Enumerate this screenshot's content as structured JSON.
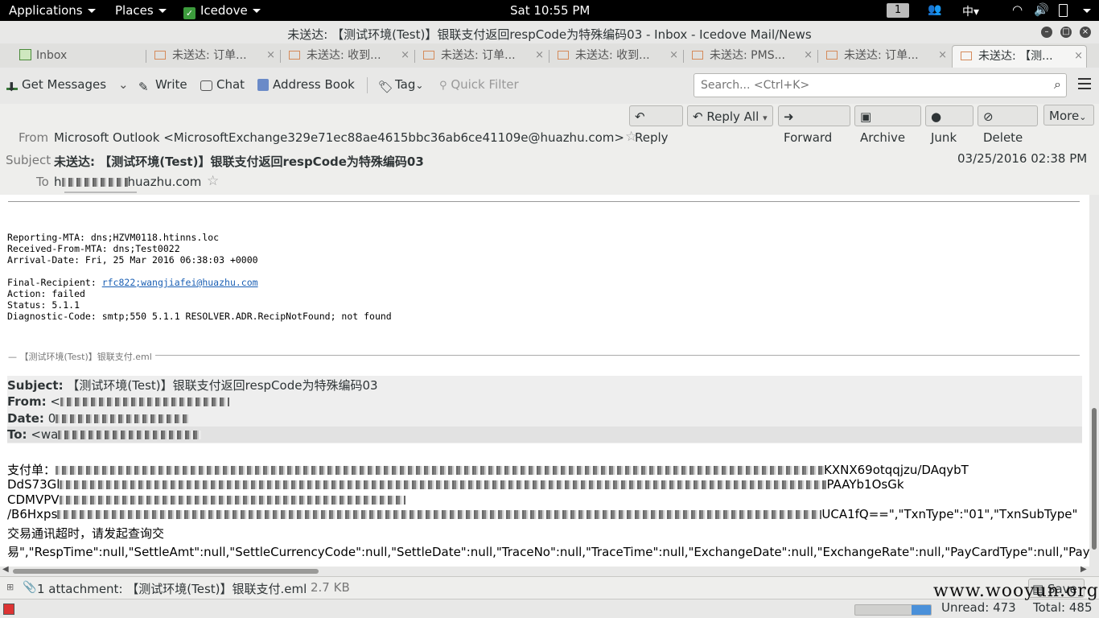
{
  "topbar": {
    "applications": "Applications",
    "places": "Places",
    "app_name": "Icedove",
    "clock": "Sat 10:55 PM",
    "workspace": "1"
  },
  "window": {
    "title": "未送达: 【测试环境(Test)】银联支付返回respCode为特殊编码03 - Inbox - Icedove Mail/News"
  },
  "tabs": [
    {
      "label": "Inbox"
    },
    {
      "label": "未送达: 订单..."
    },
    {
      "label": "未送达: 收到..."
    },
    {
      "label": "未送达: 订单..."
    },
    {
      "label": "未送达: 收到..."
    },
    {
      "label": "未送达: PMS..."
    },
    {
      "label": "未送达: 订单..."
    },
    {
      "label": "未送达: 【测..."
    }
  ],
  "toolbar": {
    "get_messages": "Get Messages",
    "write": "Write",
    "chat": "Chat",
    "address_book": "Address Book",
    "tag": "Tag",
    "quick_filter": "Quick Filter",
    "search_placeholder": "Search... <Ctrl+K>"
  },
  "header": {
    "buttons": {
      "reply": "Reply",
      "reply_all": "Reply All",
      "forward": "Forward",
      "archive": "Archive",
      "junk": "Junk",
      "delete": "Delete",
      "more": "More"
    },
    "from_label": "From",
    "from_value": "Microsoft Outlook <MicrosoftExchange329e71ec88ae4615bbc36ab6ce41109e@huazhu.com>",
    "subject_label": "Subject",
    "subject_value": "未送达: 【测试环境(Test)】银联支付返回respCode为特殊编码03",
    "date": "03/25/2016 02:38 PM",
    "to_label": "To",
    "to_prefix": "h",
    "to_suffix": "huazhu.com"
  },
  "body": {
    "report_lines_1": "Reporting-MTA: dns;HZVM0118.htinns.loc\nReceived-From-MTA: dns;Test0022\nArrival-Date: Fri, 25 Mar 2016 06:38:03 +0000",
    "final_recipient_label": "Final-Recipient: ",
    "final_recipient_link": "rfc822;wangjiafei@huazhu.com",
    "report_lines_2": "Action: failed\nStatus: 5.1.1\nDiagnostic-Code: smtp;550 5.1.1 RESOLVER.ADR.RecipNotFound; not found",
    "attached_title": "【测试环境(Test)】银联支付.eml",
    "fwd": {
      "subject_label": "Subject:",
      "subject_value": "【测试环境(Test)】银联支付返回respCode为特殊编码03",
      "from_label": "From:",
      "from_prefix": "<",
      "date_label": "Date:",
      "date_prefix": "0",
      "to_label": "To:",
      "to_prefix": "<wa"
    },
    "lines": [
      {
        "prefix": "支付单：",
        "suffix": "KXNX69otqqjzu/DAqybT"
      },
      {
        "prefix": "DdS73Gl",
        "suffix": "PAAYb1OsGk"
      },
      {
        "prefix": "CDMVPV",
        "suffix": ""
      },
      {
        "prefix": "/B6Hxps",
        "suffix": "UCA1fQ==\",\"TxnType\":\"01\",\"TxnSubType\""
      },
      {
        "prefix": "交易通讯超时，请发起查询交",
        "suffix": ""
      },
      {
        "prefix": "易\",\"RespTime\":null,\"SettleAmt\":null,\"SettleCurrencyCode\":null,\"SettleDate\":null,\"TraceNo\":null,\"TraceTime\":null,\"ExchangeDate\":null,\"ExchangeRate\":null,\"PayCardType\":null,\"PayT",
        "suffix": ""
      }
    ]
  },
  "attachment": {
    "summary": "1 attachment: 【测试环境(Test)】银联支付.eml",
    "size": "2.7 KB",
    "save": "Save"
  },
  "status": {
    "unread": "Unread: 473",
    "total": "Total: 485"
  },
  "watermark": "www.wooyun.org",
  "colors": {
    "link": "#1a5fb4",
    "progress": "#4a90d9"
  }
}
